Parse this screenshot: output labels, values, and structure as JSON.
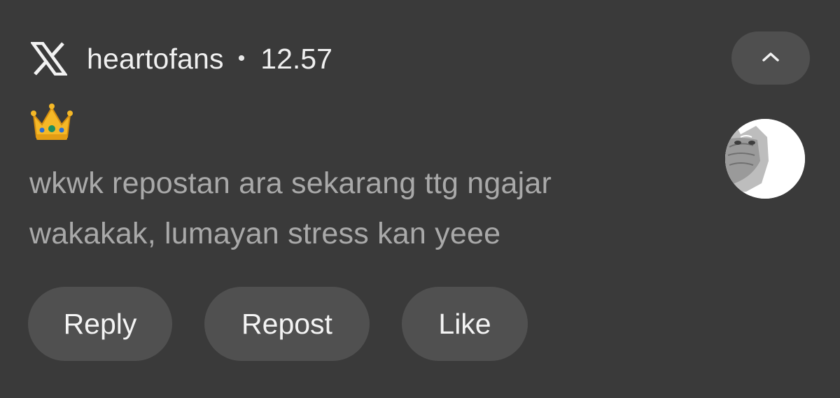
{
  "notification": {
    "app_icon": "x-logo-icon",
    "app_name": "heartofans",
    "separator": "•",
    "time": "12.57",
    "collapse_icon": "chevron-up-icon",
    "emoji": "crown-icon",
    "message_line1": "wkwk repostan ara sekarang ttg ngajar",
    "message_line2": "wakakak, lumayan stress kan yeee",
    "avatar": "cat-avatar"
  },
  "actions": {
    "reply_label": "Reply",
    "repost_label": "Repost",
    "like_label": "Like"
  },
  "colors": {
    "background": "#3a3a3a",
    "button": "#505050",
    "message_text": "#a9a9a9",
    "title_text": "#f0f0f0"
  }
}
